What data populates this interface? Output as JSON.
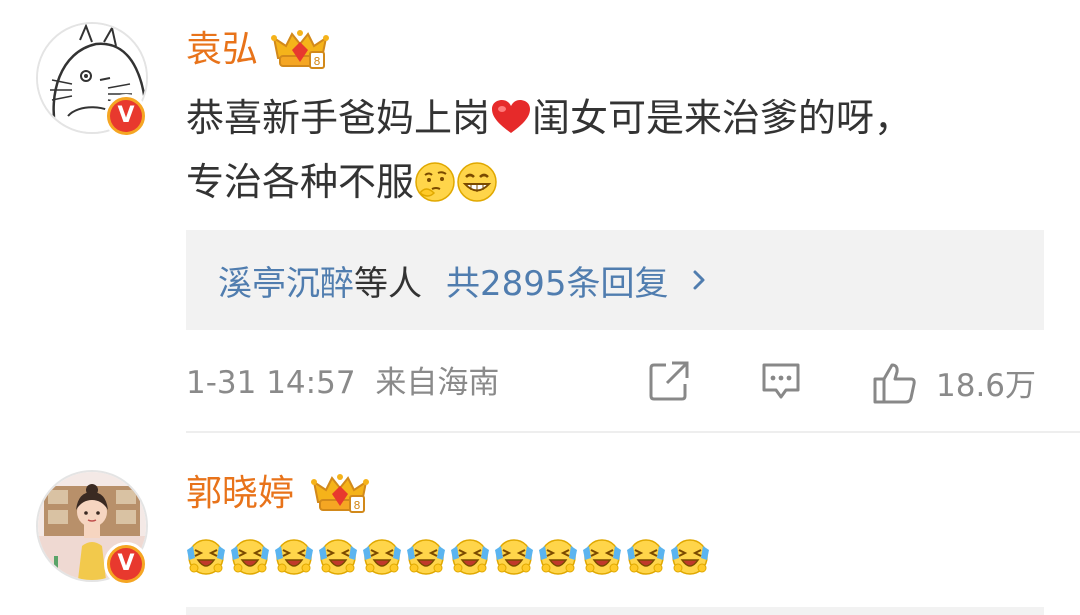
{
  "comments": [
    {
      "username": "袁弘",
      "text_line1_part1": "恭喜新手爸妈上岗",
      "text_line1_part2": "闺女可是来治爹的呀，",
      "text_line2": "专治各种不服",
      "reply_summary": {
        "users": "溪亭沉醉",
        "users_suffix": "等人",
        "total": "共2895条回复"
      },
      "timestamp": "1-31 14:57",
      "source": "来自海南",
      "likes": "18.6万"
    },
    {
      "username": "郭晓婷",
      "emoji_count": 12
    }
  ],
  "colors": {
    "username": "#e8731a",
    "link": "#507daf",
    "meta": "#8a8a8a",
    "verified_outer": "#f5a623",
    "verified_inner": "#e8392e"
  },
  "icons": {
    "repost": "share-box-icon",
    "comment": "comment-bubble-icon",
    "like": "thumbs-up-icon",
    "verified": "v-badge-icon",
    "member": "crown-badge-icon"
  },
  "verified_label": "V"
}
